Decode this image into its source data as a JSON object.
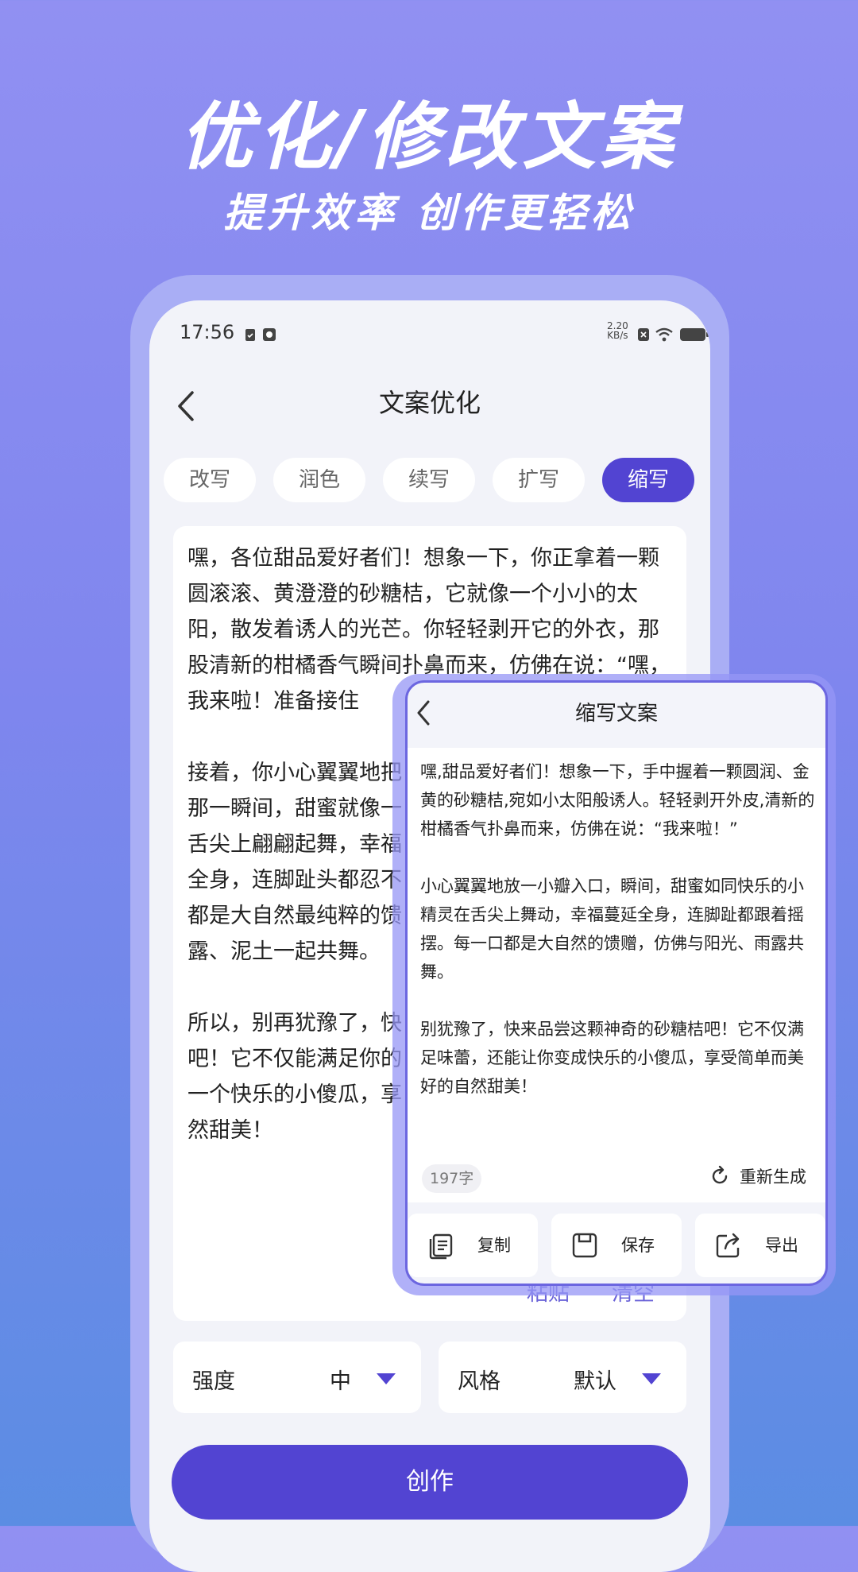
{
  "hero": {
    "title": "优化/修改文案",
    "subtitle": "提升效率 创作更轻松"
  },
  "status_bar": {
    "time": "17:56",
    "net_speed": "2.20\nKB/s"
  },
  "nav": {
    "title": "文案优化"
  },
  "tabs": [
    {
      "label": "改写",
      "active": false
    },
    {
      "label": "润色",
      "active": false
    },
    {
      "label": "续写",
      "active": false
    },
    {
      "label": "扩写",
      "active": false
    },
    {
      "label": "缩写",
      "active": true
    }
  ],
  "editor": {
    "text": "嘿，各位甜品爱好者们！想象一下，你正拿着一颗圆滚滚、黄澄澄的砂糖桔，它就像一个小小的太阳，散发着诱人的光芒。你轻轻剥开它的外衣，那股清新的柑橘香气瞬间扑鼻而来，仿佛在说：“嘿，我来啦！准备接住\n\n接着，你小心翼翼地把\n那一瞬间，甜蜜就像一\n舌尖上翩翩起舞，幸福\n全身，连脚趾头都忍不\n都是大自然最纯粹的馈\n露、泥土一起共舞。\n\n所以，别再犹豫了，快\n吧！它不仅能满足你的\n一个快乐的小傻瓜，享\n然甜美！",
    "paste_label": "粘贴",
    "clear_label": "清空"
  },
  "options": {
    "strength_label": "强度",
    "strength_value": "中",
    "style_label": "风格",
    "style_value": "默认"
  },
  "create_label": "创作",
  "popup": {
    "title": "缩写文案",
    "text": "嘿,甜品爱好者们！想象一下，手中握着一颗圆润、金黄的砂糖桔,宛如小太阳般诱人。轻轻剥开外皮,清新的柑橘香气扑鼻而来，仿佛在说：“我来啦！”\n\n小心翼翼地放一小瓣入口，瞬间，甜蜜如同快乐的小精灵在舌尖上舞动，幸福蔓延全身，连脚趾都跟着摇摆。每一口都是大自然的馈赠，仿佛与阳光、雨露共舞。\n\n别犹豫了，快来品尝这颗神奇的砂糖桔吧！它不仅满足味蕾，还能让你变成快乐的小傻瓜，享受简单而美好的自然甜美！",
    "count": "197字",
    "regenerate_label": "重新生成",
    "actions": [
      {
        "label": "复制",
        "icon": "copy-icon"
      },
      {
        "label": "保存",
        "icon": "save-icon"
      },
      {
        "label": "导出",
        "icon": "export-icon"
      }
    ]
  },
  "colors": {
    "accent": "#5244d2",
    "link": "#6a63d8"
  }
}
